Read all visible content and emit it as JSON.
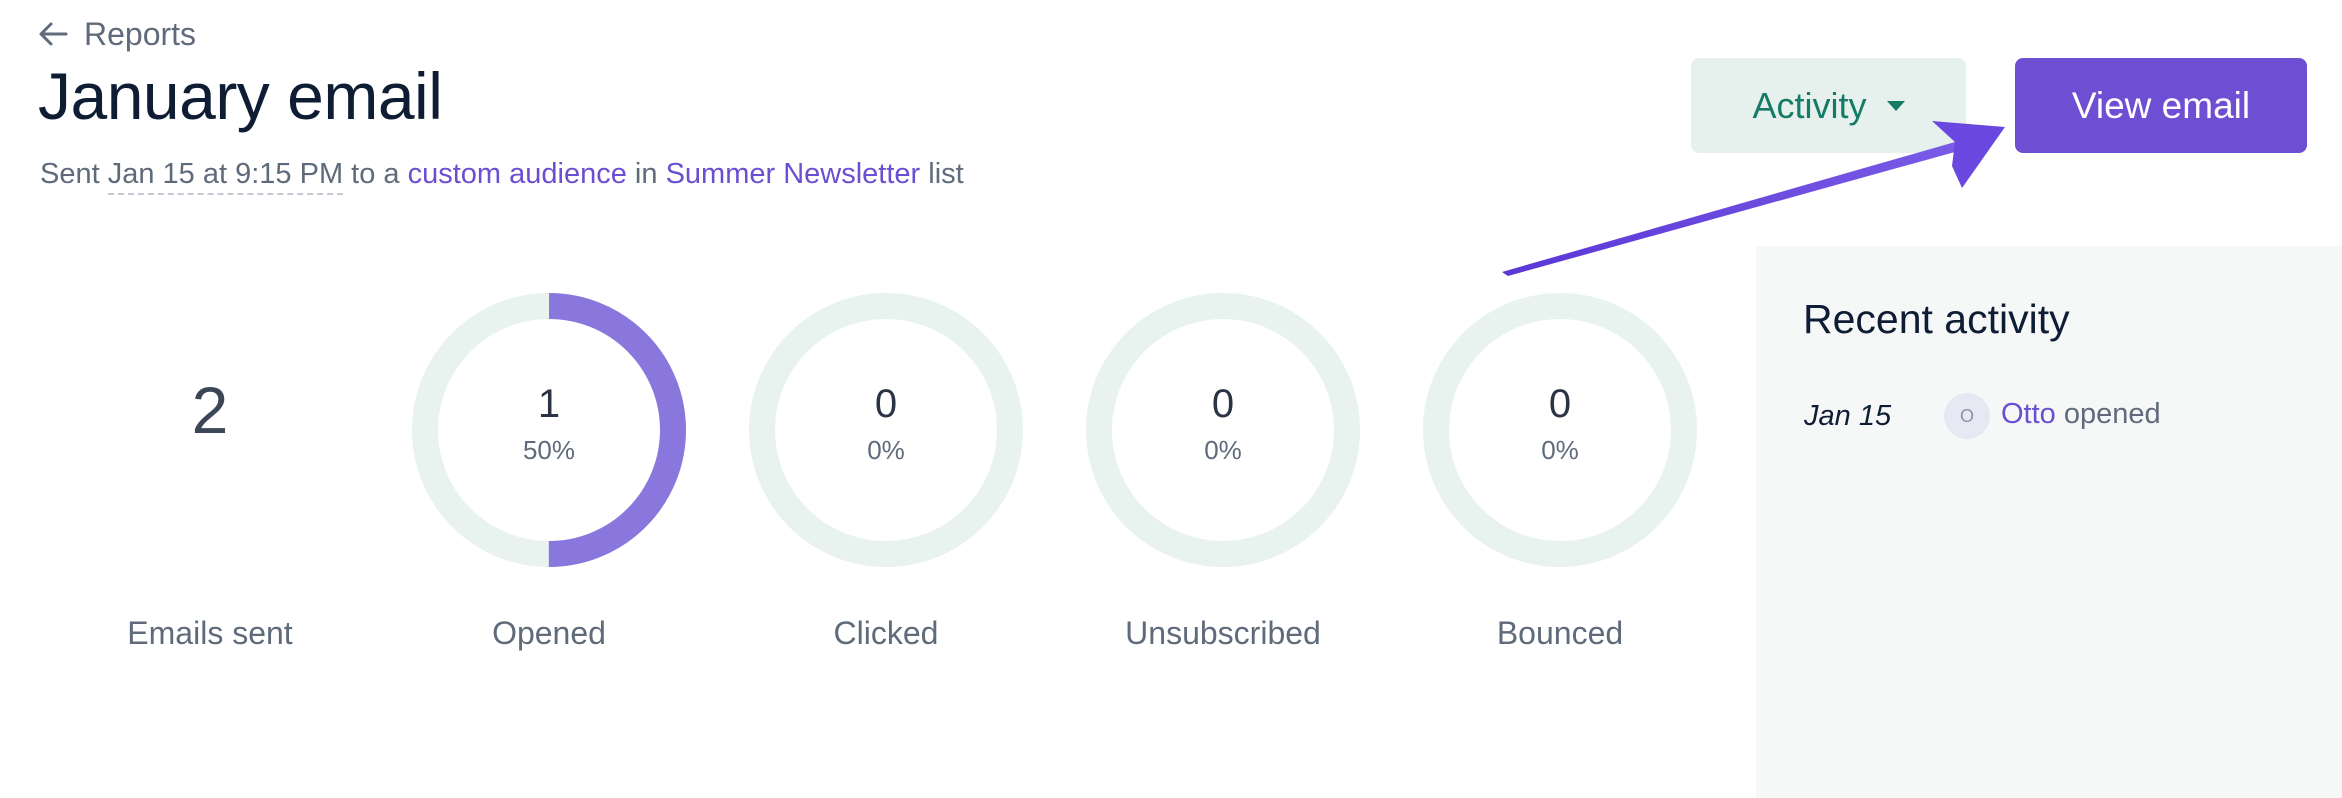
{
  "header": {
    "back_label": "Reports",
    "title": "January email",
    "subtitle": {
      "prefix": "Sent",
      "sent_at": "Jan 15 at 9:15 PM",
      "to_text": "to a",
      "audience_link": "custom audience",
      "in_text": "in",
      "list_link": "Summer Newsletter",
      "suffix": "list"
    }
  },
  "actions": {
    "activity_label": "Activity",
    "view_email_label": "View email"
  },
  "stats": {
    "emails_sent": {
      "value": "2",
      "label": "Emails sent"
    },
    "opened": {
      "count": "1",
      "percent": "50%",
      "fraction": 0.5,
      "label": "Opened"
    },
    "clicked": {
      "count": "0",
      "percent": "0%",
      "fraction": 0,
      "label": "Clicked"
    },
    "unsubscribed": {
      "count": "0",
      "percent": "0%",
      "fraction": 0,
      "label": "Unsubscribed"
    },
    "bounced": {
      "count": "0",
      "percent": "0%",
      "fraction": 0,
      "label": "Bounced"
    }
  },
  "recent_activity": {
    "title": "Recent activity",
    "items": [
      {
        "date": "Jan 15",
        "avatar_initial": "O",
        "name": "Otto",
        "action": "opened"
      }
    ]
  },
  "colors": {
    "accent": "#6e4fd3",
    "donut_fill": "#8a77dd",
    "donut_track": "#e8f2ef",
    "activity_button_bg": "#e6f1ed",
    "activity_button_text": "#157a66",
    "link": "#6a4fd2"
  },
  "icons": {
    "back": "arrow-left-icon",
    "dropdown": "caret-down-icon",
    "annotation": "annotation-arrow-icon"
  }
}
